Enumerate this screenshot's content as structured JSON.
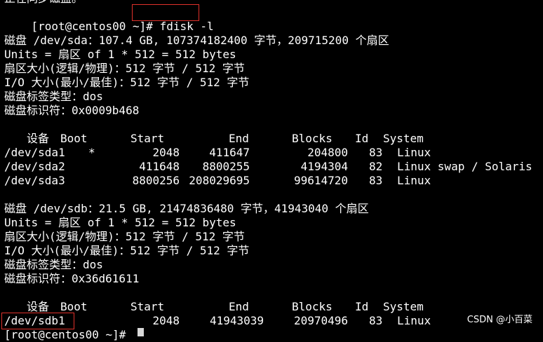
{
  "terminal": {
    "top_partial": "正在同步磁盘。",
    "prompt": "[root@centos00 ~]#",
    "command": "fdisk -l",
    "disk1": {
      "summary": "磁盘 /dev/sda：107.4 GB, 107374182400 字节，209715200 个扇区",
      "units": "Units = 扇区 of 1 * 512 = 512 bytes",
      "sector_size": "扇区大小(逻辑/物理)：512 字节 / 512 字节",
      "io_size": "I/O 大小(最小/最佳)：512 字节 / 512 字节",
      "label_type": "磁盘标签类型：dos",
      "identifier": "磁盘标识符：0x0009b468"
    },
    "table1": {
      "headers": {
        "device": "设备",
        "boot": "Boot",
        "start": "Start",
        "end": "End",
        "blocks": "Blocks",
        "id": "Id",
        "system": "System"
      },
      "rows": [
        {
          "device": "/dev/sda1",
          "boot": "*",
          "start": "2048",
          "end": "411647",
          "blocks": "204800",
          "id": "83",
          "system": "Linux"
        },
        {
          "device": "/dev/sda2",
          "boot": "",
          "start": "411648",
          "end": "8800255",
          "blocks": "4194304",
          "id": "82",
          "system": "Linux swap / Solaris"
        },
        {
          "device": "/dev/sda3",
          "boot": "",
          "start": "8800256",
          "end": "208029695",
          "blocks": "99614720",
          "id": "83",
          "system": "Linux"
        }
      ]
    },
    "disk2": {
      "summary": "磁盘 /dev/sdb：21.5 GB, 21474836480 字节，41943040 个扇区",
      "units": "Units = 扇区 of 1 * 512 = 512 bytes",
      "sector_size": "扇区大小(逻辑/物理)：512 字节 / 512 字节",
      "io_size": "I/O 大小(最小/最佳)：512 字节 / 512 字节",
      "label_type": "磁盘标签类型：dos",
      "identifier": "磁盘标识符：0x36d61611"
    },
    "table2": {
      "headers": {
        "device": "设备",
        "boot": "Boot",
        "start": "Start",
        "end": "End",
        "blocks": "Blocks",
        "id": "Id",
        "system": "System"
      },
      "rows": [
        {
          "device": "/dev/sdb1",
          "boot": "",
          "start": "2048",
          "end": "41943039",
          "blocks": "20970496",
          "id": "83",
          "system": "Linux"
        }
      ]
    },
    "last_prompt_partial": "[root@centos00 ~]#"
  },
  "watermark": "CSDN @小百菜",
  "colors": {
    "background": "#000000",
    "text": "#ffffff",
    "highlight_box": "#e0312b"
  }
}
